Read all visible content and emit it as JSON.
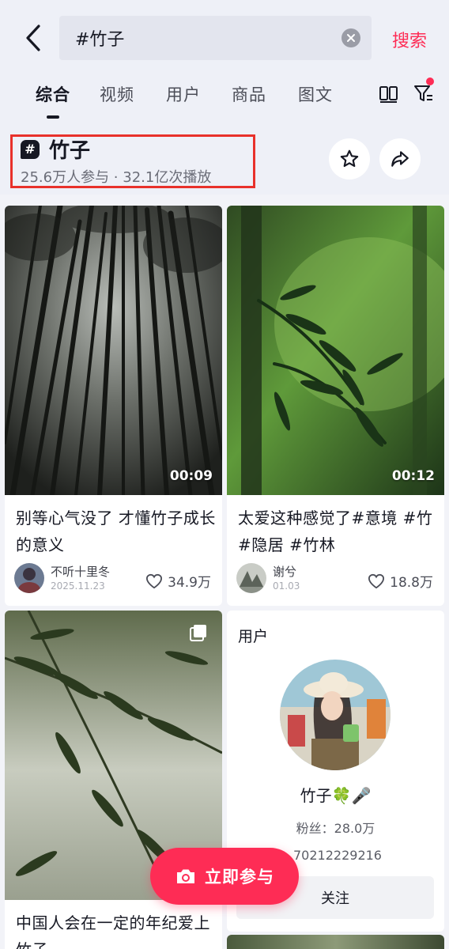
{
  "search": {
    "value": "#竹子",
    "submit_label": "搜索"
  },
  "tabs": [
    {
      "label": "综合",
      "active": true
    },
    {
      "label": "视频",
      "active": false
    },
    {
      "label": "用户",
      "active": false
    },
    {
      "label": "商品",
      "active": false
    },
    {
      "label": "图文",
      "active": false
    }
  ],
  "topic": {
    "hash_symbol": "#",
    "title": "竹子",
    "stats": "25.6万人参与 · 32.1亿次播放"
  },
  "feed": {
    "cards": [
      {
        "duration": "00:09",
        "title": "别等心气没了 才懂竹子成长的意义",
        "author": "不听十里冬",
        "date": "2025.11.23",
        "likes": "34.9万"
      },
      {
        "duration": "00:12",
        "title": "太爱这种感觉了#意境 #竹 #隐居 #竹林",
        "author": "谢兮",
        "date": "01.03",
        "likes": "18.8万"
      },
      {
        "title": "中国人会在一定的年纪爱上竹子"
      }
    ],
    "user_card": {
      "section_label": "用户",
      "name": "竹子🍀🎤",
      "fans": "粉丝：28.0万",
      "id": "抖音号：70212229216",
      "follow_label": "关注"
    }
  },
  "join_button": {
    "label": "立即参与"
  },
  "colors": {
    "accent": "#fe2c55",
    "highlight": "#e8312b",
    "background": "#f2f3f8",
    "header_background": "#eef0f7"
  },
  "icons": [
    "back-arrow-icon",
    "clear-icon",
    "layout-icon",
    "filter-icon",
    "star-icon",
    "share-icon",
    "heart-icon",
    "camera-icon",
    "album-icon"
  ]
}
